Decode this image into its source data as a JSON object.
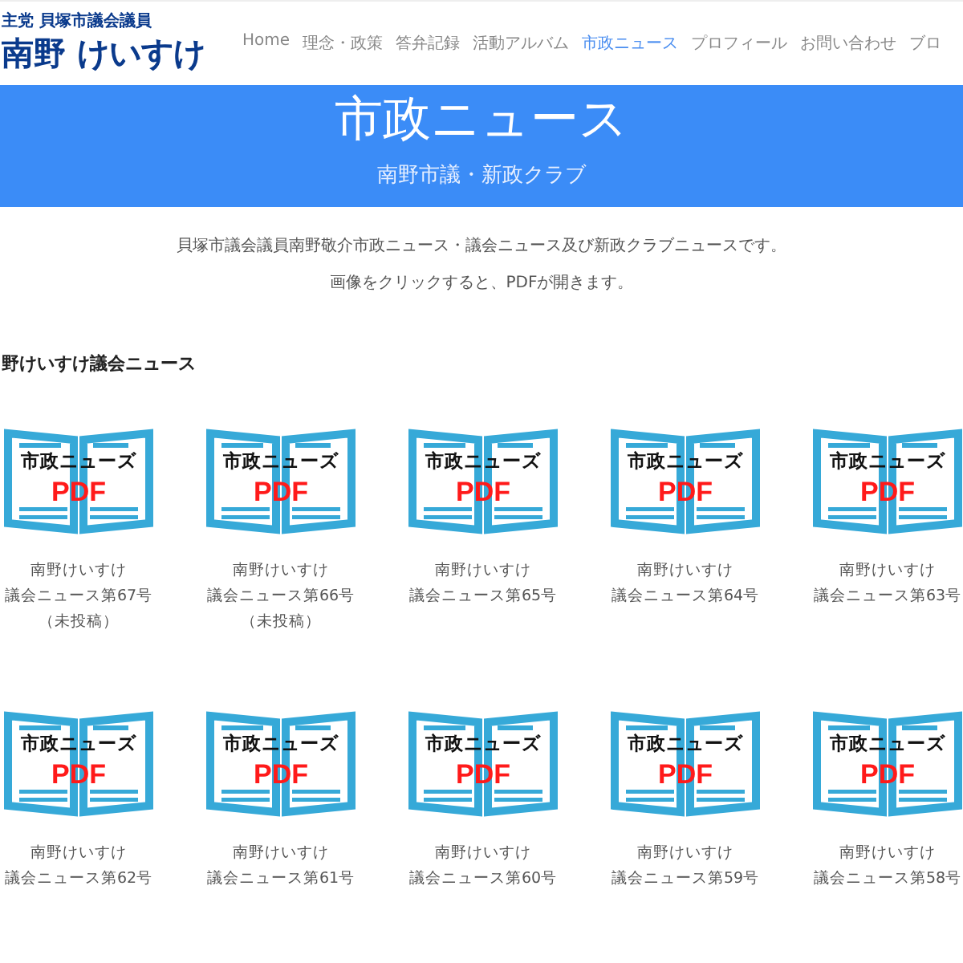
{
  "header": {
    "logo_tagline": "主党 貝塚市議会議員",
    "logo_name": "南野 けいすけ",
    "nav": [
      {
        "label": "Home",
        "selected": false
      },
      {
        "label": "理念・政策",
        "selected": false
      },
      {
        "label": "答弁記録",
        "selected": false
      },
      {
        "label": "活動アルバム",
        "selected": false
      },
      {
        "label": "市政ニュース",
        "selected": true
      },
      {
        "label": "プロフィール",
        "selected": false
      },
      {
        "label": "お問い合わせ",
        "selected": false
      },
      {
        "label": "ブロ",
        "selected": false
      }
    ]
  },
  "banner": {
    "title": "市政ニュース",
    "subtitle": "南野市議・新政クラブ"
  },
  "intro": [
    "貝塚市議会議員南野敬介市政ニュース・議会ニュース及び新政クラブニュースです。",
    "画像をクリックすると、PDFが開きます。"
  ],
  "section_heading": "野けいすけ議会ニュース",
  "items": [
    {
      "icon_title": "市政ニューズ",
      "icon_label": "PDF",
      "caption": [
        "南野けいすけ",
        "議会ニュース第67号",
        "（未投稿）"
      ]
    },
    {
      "icon_title": "市政ニューズ",
      "icon_label": "PDF",
      "caption": [
        "南野けいすけ",
        "議会ニュース第66号",
        "（未投稿）"
      ]
    },
    {
      "icon_title": "市政ニューズ",
      "icon_label": "PDF",
      "caption": [
        "南野けいすけ",
        "議会ニュース第65号"
      ]
    },
    {
      "icon_title": "市政ニューズ",
      "icon_label": "PDF",
      "caption": [
        "南野けいすけ",
        "議会ニュース第64号"
      ]
    },
    {
      "icon_title": "市政ニューズ",
      "icon_label": "PDF",
      "caption": [
        "南野けいすけ",
        "議会ニュース第63号"
      ]
    },
    {
      "icon_title": "市政ニューズ",
      "icon_label": "PDF",
      "caption": [
        "南野けいすけ",
        "議会ニュース第62号"
      ]
    },
    {
      "icon_title": "市政ニューズ",
      "icon_label": "PDF",
      "caption": [
        "南野けいすけ",
        "議会ニュース第61号"
      ]
    },
    {
      "icon_title": "市政ニューズ",
      "icon_label": "PDF",
      "caption": [
        "南野けいすけ",
        "議会ニュース第60号"
      ]
    },
    {
      "icon_title": "市政ニューズ",
      "icon_label": "PDF",
      "caption": [
        "南野けいすけ",
        "議会ニュース第59号"
      ]
    },
    {
      "icon_title": "市政ニューズ",
      "icon_label": "PDF",
      "caption": [
        "南野けいすけ",
        "議会ニュース第58号"
      ]
    }
  ]
}
